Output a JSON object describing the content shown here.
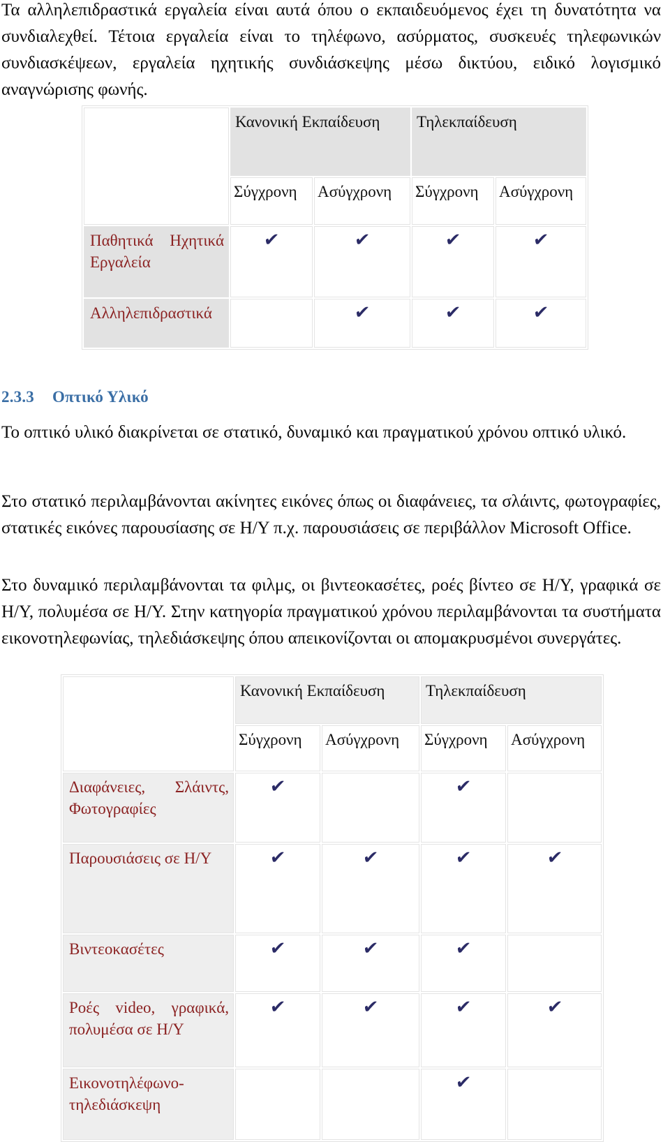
{
  "document": {
    "intro_paragraph": "Τα αλληλεπιδραστικά εργαλεία είναι αυτά όπου ο εκπαιδευόμενος έχει τη δυνατότητα να συνδιαλεχθεί. Τέτοια εργαλεία είναι το τηλέφωνο, ασύρματος, συσκευές τηλεφωνικών συνδιασκέψεων, εργαλεία ηχητικής συνδιάσκεψης μέσω δικτύου, ειδικό λογισμικό αναγνώρισης φωνής.",
    "heading": {
      "number": "2.3.3",
      "title": "Οπτικό Υλικό",
      "color": "#3a6ea5"
    },
    "paragraphs": {
      "optiko": "Το οπτικό υλικό διακρίνεται σε στατικό, δυναμικό και πραγματικού χρόνου οπτικό υλικό.",
      "statiko": "Στο στατικό περιλαμβάνονται ακίνητες εικόνες όπως οι διαφάνειες, τα σλάιντς, φωτογραφίες, στατικές εικόνες παρουσίασης σε Η/Υ π.χ. παρουσιάσεις σε περιβάλλον Microsoft Office.",
      "dynamiko": "Στο δυναμικό περιλαμβάνονται τα φιλμς, οι βιντεοκασέτες, ροές βίντεο σε Η/Υ, γραφικά σε Η/Υ, πολυμέσα σε Η/Υ. Στην κατηγορία πραγματικού χρόνου περιλαμβάνονται τα συστήματα εικονοτηλεφωνίας, τηλεδιάσκεψης όπου απεικονίζονται οι απομακρυσμένοι συνεργάτες."
    }
  },
  "styles": {
    "check_color": "#2b2b66",
    "row_label_color": "#8b2222",
    "header_fill": "#e2e2e2",
    "header_fill_light": "#eeeeee"
  },
  "table_audio": {
    "check_glyph": "✔",
    "group_headers": [
      "Κανονική Εκπαίδευση",
      "Τηλεκπαίδευση"
    ],
    "sub_headers": [
      "Σύγχρονη",
      "Ασύγχρονη",
      "Σύγχρονη",
      "Ασύγχρονη"
    ],
    "rows": [
      {
        "label": "Παθητικά Ηχητικά Εργαλεία",
        "checks": [
          true,
          true,
          true,
          true
        ]
      },
      {
        "label": "Αλληλεπιδραστικά",
        "checks": [
          false,
          true,
          true,
          true
        ]
      }
    ]
  },
  "table_visual": {
    "check_glyph": "✔",
    "group_headers": [
      "Κανονική Εκπαίδευση",
      "Τηλεκπαίδευση"
    ],
    "sub_headers": [
      "Σύγχρονη",
      "Ασύγχρονη",
      "Σύγχρονη",
      "Ασύγχρονη"
    ],
    "rows": [
      {
        "label": "Διαφάνειες, Σλάιντς, Φωτογραφίες",
        "checks": [
          true,
          false,
          true,
          false
        ]
      },
      {
        "label": "Παρουσιάσεις σε Η/Υ",
        "checks": [
          true,
          true,
          true,
          true
        ]
      },
      {
        "label": "Βιντεοκασέτες",
        "checks": [
          true,
          true,
          true,
          false
        ]
      },
      {
        "label": "Ροές video, γραφικά, πολυμέσα σε Η/Υ",
        "checks": [
          true,
          true,
          true,
          true
        ]
      },
      {
        "label": "Εικονοτηλέφωνο-τηλεδιάσκεψη",
        "checks": [
          false,
          false,
          true,
          false
        ]
      }
    ]
  }
}
